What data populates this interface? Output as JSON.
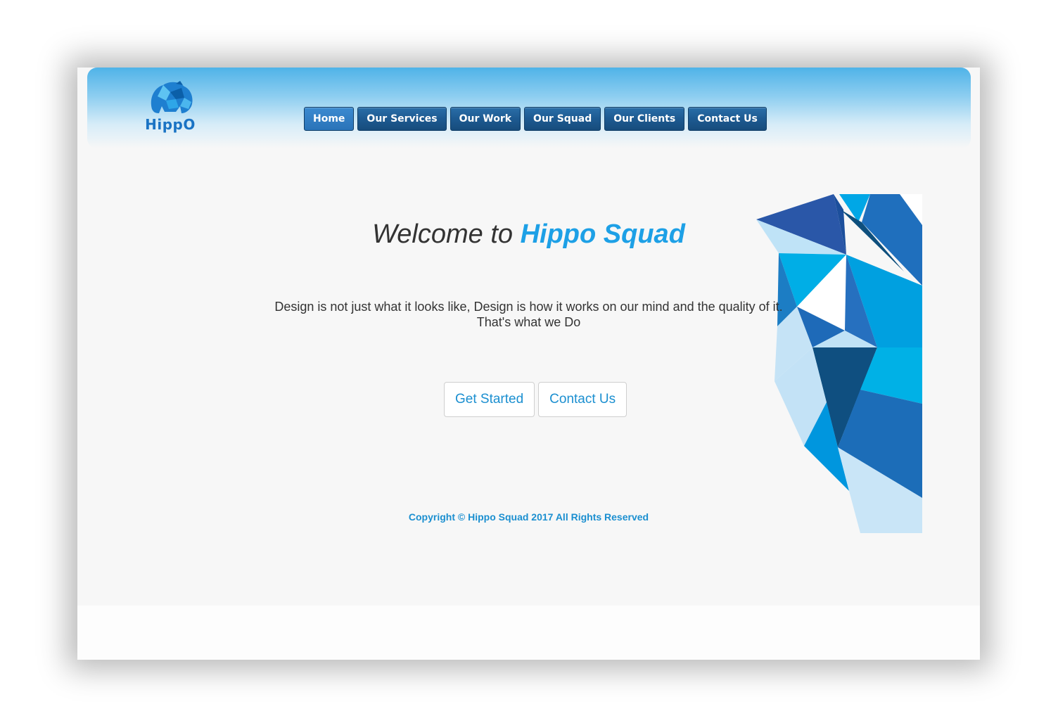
{
  "brand": {
    "logo_text": "HippO",
    "logo_icon": "hippo-logo-icon"
  },
  "nav": {
    "items": [
      {
        "label": "Home",
        "active": true
      },
      {
        "label": "Our Services"
      },
      {
        "label": "Our Work"
      },
      {
        "label": "Our Squad"
      },
      {
        "label": "Our Clients"
      },
      {
        "label": "Contact Us"
      }
    ]
  },
  "hero": {
    "welcome_prefix": "Welcome to",
    "welcome_brand": "Hippo Squad",
    "tagline_line1": "Design is not just what it looks like, Design is how it works on our mind and the quality of it.",
    "tagline_line2": "That's what we Do"
  },
  "cta": {
    "get_started": "Get Started",
    "contact_us": "Contact Us"
  },
  "footer": {
    "copyright": "Copyright ©  Hippo Squad  2017 All Rights Reserved"
  },
  "colors": {
    "accent": "#1da0e6",
    "nav_bg": "#1d5a91",
    "link": "#1b8fd0"
  }
}
